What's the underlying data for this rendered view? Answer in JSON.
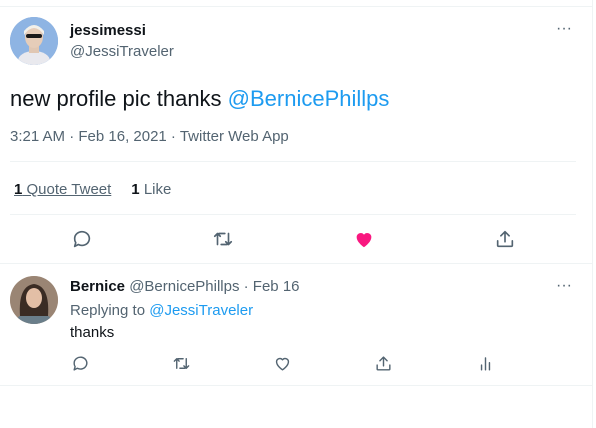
{
  "tweet": {
    "display_name": "jessimessi",
    "handle": "@JessiTraveler",
    "text_prefix": "new profile pic thanks ",
    "mention": "@BernicePhillps",
    "meta": "3:21 AM · Feb 16, 2021 · Twitter Web App",
    "quote_count": "1",
    "quote_label": "Quote Tweet",
    "like_count": "1",
    "like_label": "Like",
    "more": "···",
    "liked": true,
    "like_color": "#f91880"
  },
  "reply": {
    "display_name": "Bernice",
    "meta": "@BernicePhillps · Feb 16",
    "replying_prefix": "Replying to ",
    "replying_to": "@JessiTraveler",
    "text": "thanks",
    "more": "···"
  },
  "icons": [
    "reply-icon",
    "retweet-icon",
    "like-icon",
    "share-icon",
    "analytics-icon",
    "more-icon"
  ],
  "colors": {
    "accent": "#1d9bf0",
    "secondary_text": "#536471",
    "like": "#f91880"
  }
}
